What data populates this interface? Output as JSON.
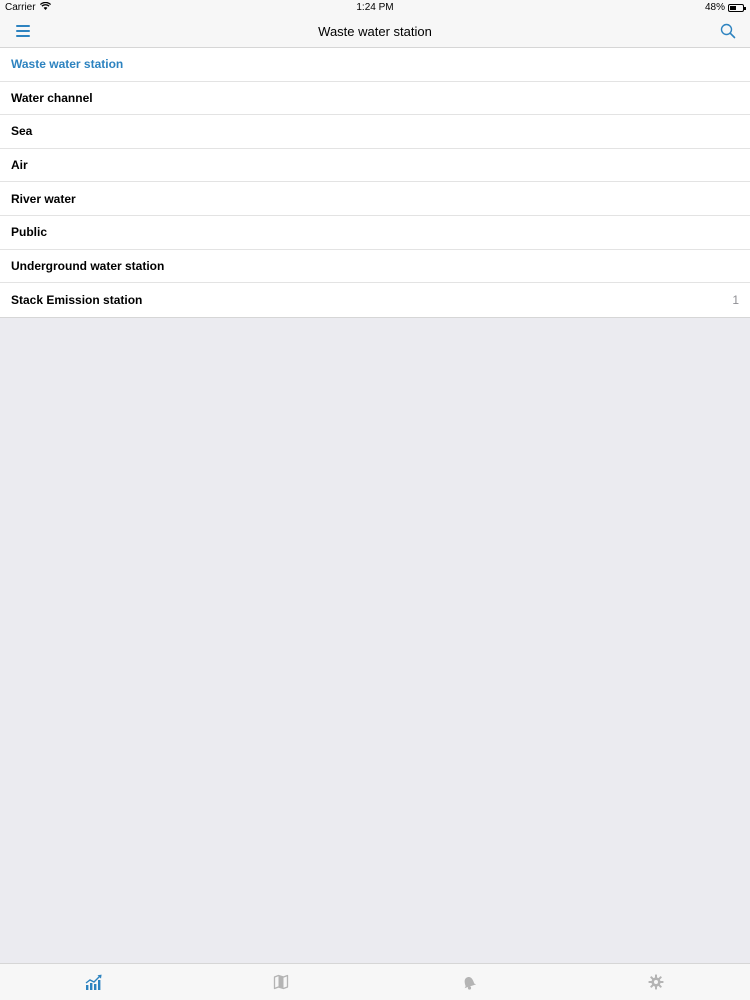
{
  "status_bar": {
    "carrier": "Carrier",
    "time": "1:24 PM",
    "battery": "48%",
    "battery_level": 0.48
  },
  "nav": {
    "title": "Waste water station",
    "menu_icon": "hamburger-icon",
    "search_icon": "search-icon"
  },
  "list": {
    "items": [
      {
        "label": "Waste water station",
        "count": ""
      },
      {
        "label": "Water channel",
        "count": ""
      },
      {
        "label": "Sea",
        "count": ""
      },
      {
        "label": "Air",
        "count": ""
      },
      {
        "label": "River water",
        "count": ""
      },
      {
        "label": "Public",
        "count": ""
      },
      {
        "label": "Underground water station",
        "count": ""
      },
      {
        "label": "Stack Emission station",
        "count": "1"
      }
    ],
    "selected_index": 0
  },
  "tabs": [
    {
      "icon": "chart-icon",
      "active": true
    },
    {
      "icon": "map-icon",
      "active": false
    },
    {
      "icon": "bell-icon",
      "active": false
    },
    {
      "icon": "gear-icon",
      "active": false
    }
  ],
  "colors": {
    "accent": "#2d83c0",
    "inactive_icon": "#b4b4b4",
    "background": "#ebebf0"
  }
}
